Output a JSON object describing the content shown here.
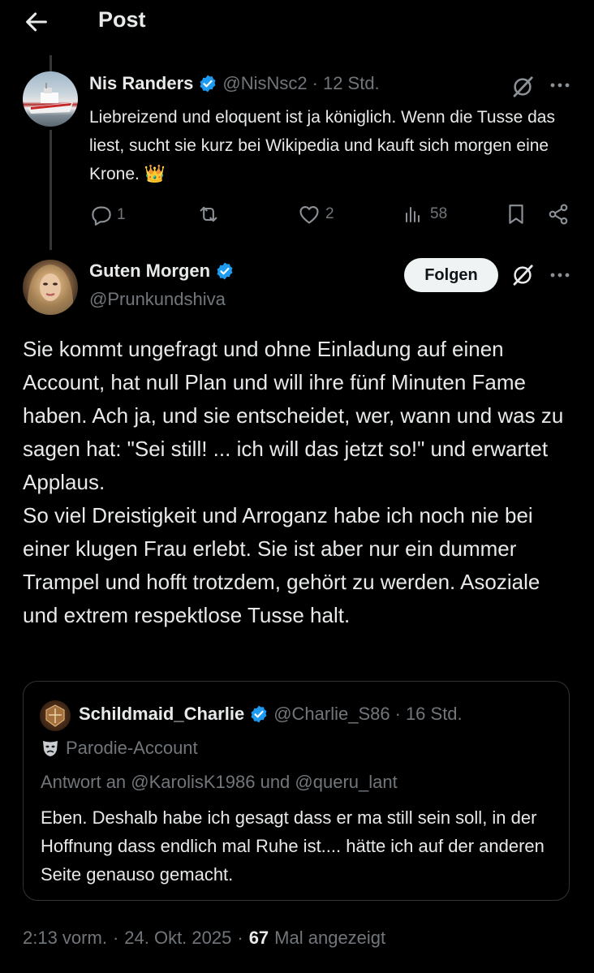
{
  "header": {
    "title": "Post"
  },
  "reply": {
    "display_name": "Nis Randers",
    "handle": "@NisNsc2",
    "sep": "·",
    "time": "12 Std.",
    "text": "Liebreizend und eloquent ist ja königlich. Wenn die Tusse das liest, sucht sie kurz bei Wikipedia und kauft sich morgen eine Krone. 👑",
    "replies": "1",
    "likes": "2",
    "views": "58"
  },
  "main": {
    "display_name": "Guten Morgen",
    "handle": "@Prunkundshiva",
    "follow_label": "Folgen",
    "paragraph1": "Sie kommt ungefragt und ohne Einladung auf einen Account, hat null Plan und will ihre fünf Minuten Fame haben. Ach ja, und sie entscheidet, wer, wann und was zu sagen hat: \"Sei still! ... ich will das jetzt so!\" und erwartet Applaus.",
    "paragraph2": "So viel Dreistigkeit und Arroganz habe ich noch nie bei einer klugen Frau erlebt. Sie ist aber nur ein dummer Trampel und hofft trotzdem, gehört zu werden. Asoziale und extrem respektlose Tusse halt."
  },
  "quote": {
    "display_name": "Schildmaid_Charlie",
    "handle": "@Charlie_S86",
    "sep": "·",
    "time": "16 Std.",
    "parody_label": "Parodie-Account",
    "reply_to": "Antwort an @KarolisK1986 und @queru_lant",
    "text": "Eben. Deshalb habe ich gesagt dass er ma still sein soll, in der Hoffnung dass endlich mal Ruhe ist.... hätte ich auf der anderen Seite genauso gemacht."
  },
  "footer": {
    "time": "2:13 vorm.",
    "sep": "·",
    "date": "24. Okt. 2025",
    "sep2": "·",
    "views_count": "67",
    "views_label": "Mal angezeigt"
  },
  "colors": {
    "accent": "#1d9bf0",
    "background": "#000000",
    "text": "#e7e9ea",
    "muted": "#71767b",
    "border": "#2f3336"
  }
}
